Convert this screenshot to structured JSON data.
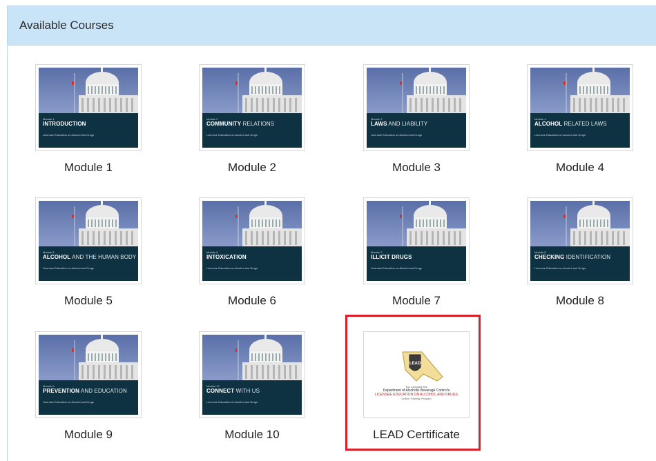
{
  "panel": {
    "title": "Available Courses"
  },
  "modules": [
    {
      "caption": "Module 1",
      "small": "Module 1",
      "bold": "INTRODUCTION",
      "light": "",
      "sub": "Licensee Education on Alcohol and Drugs"
    },
    {
      "caption": "Module 2",
      "small": "Module 2",
      "bold": "COMMUNITY",
      "light": " RELATIONS",
      "sub": "Licensee Education on Alcohol and Drugs"
    },
    {
      "caption": "Module 3",
      "small": "Module 3",
      "bold": "LAWS",
      "light": " AND LIABILITY",
      "sub": "Licensee Education on Alcohol and Drugs"
    },
    {
      "caption": "Module 4",
      "small": "Module 4",
      "bold": "ALCOHOL",
      "light": " RELATED LAWS",
      "sub": "Licensee Education on Alcohol and Drugs"
    },
    {
      "caption": "Module 5",
      "small": "Module 5",
      "bold": "ALCOHOL",
      "light": " AND THE HUMAN BODY",
      "sub": "Licensee Education on Alcohol and Drugs"
    },
    {
      "caption": "Module 6",
      "small": "Module 6",
      "bold": "INTOXICATION",
      "light": "",
      "sub": "Licensee Education on Alcohol and Drugs"
    },
    {
      "caption": "Module 7",
      "small": "Module 7",
      "bold": "ILLICIT DRUGS",
      "light": "",
      "sub": "Licensee Education on Alcohol and Drugs"
    },
    {
      "caption": "Module 8",
      "small": "Module 8",
      "bold": "CHECKING",
      "light": " IDENTIFICATION",
      "sub": "Licensee Education on Alcohol and Drugs"
    },
    {
      "caption": "Module 9",
      "small": "Module 9",
      "bold": "PREVENTION",
      "light": " AND EDUCATION",
      "sub": "Licensee Education on Alcohol and Drugs"
    },
    {
      "caption": "Module 10",
      "small": "Module 10",
      "bold": "CONNECT",
      "light": " WITH US",
      "sub": "Licensee Education on Alcohol and Drugs"
    }
  ],
  "certificate": {
    "caption": "LEAD Certificate",
    "logo_text": "LEAD",
    "line1": "You Complete the",
    "line2": "Department of Alcoholic Beverage Control's",
    "line3": "LICENSEE EDUCATION ON ALCOHOL AND DRUGS",
    "line4": "Online Training Program"
  },
  "colors": {
    "header_bg": "#c9e3f7",
    "overlay_bg": "#0f3243",
    "highlight": "#d9202a"
  }
}
